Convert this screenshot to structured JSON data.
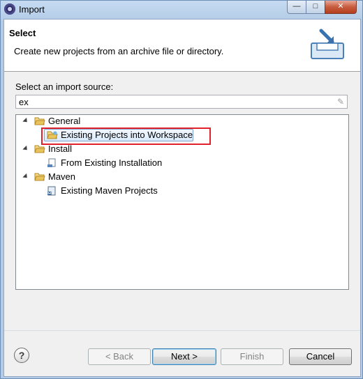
{
  "window": {
    "title": "Import",
    "controls": {
      "minimize": "—",
      "maximize": "□",
      "close": "✕"
    }
  },
  "header": {
    "title": "Select",
    "description": "Create new projects from an archive file or directory.",
    "icon": "import-wizard-icon"
  },
  "source": {
    "label": "Select an import source:",
    "filter_value": "ex",
    "clear_icon": "eraser-icon"
  },
  "tree": {
    "groups": [
      {
        "label": "General",
        "icon": "folder-open-icon",
        "expanded": true,
        "items": [
          {
            "label": "Existing Projects into Workspace",
            "icon": "projects-icon",
            "selected": true
          }
        ]
      },
      {
        "label": "Install",
        "icon": "folder-open-icon",
        "expanded": true,
        "items": [
          {
            "label": "From Existing Installation",
            "icon": "installation-icon"
          }
        ]
      },
      {
        "label": "Maven",
        "icon": "folder-open-icon",
        "expanded": true,
        "items": [
          {
            "label": "Existing Maven Projects",
            "icon": "maven-icon"
          }
        ]
      }
    ]
  },
  "buttons": {
    "help": "?",
    "back": "< Back",
    "next": "Next >",
    "finish": "Finish",
    "cancel": "Cancel"
  },
  "colors": {
    "selection_fill": "#dbebfc",
    "selection_border": "#7da2ce",
    "highlight_box": "#e0202a",
    "folder": "#e8c45a"
  }
}
